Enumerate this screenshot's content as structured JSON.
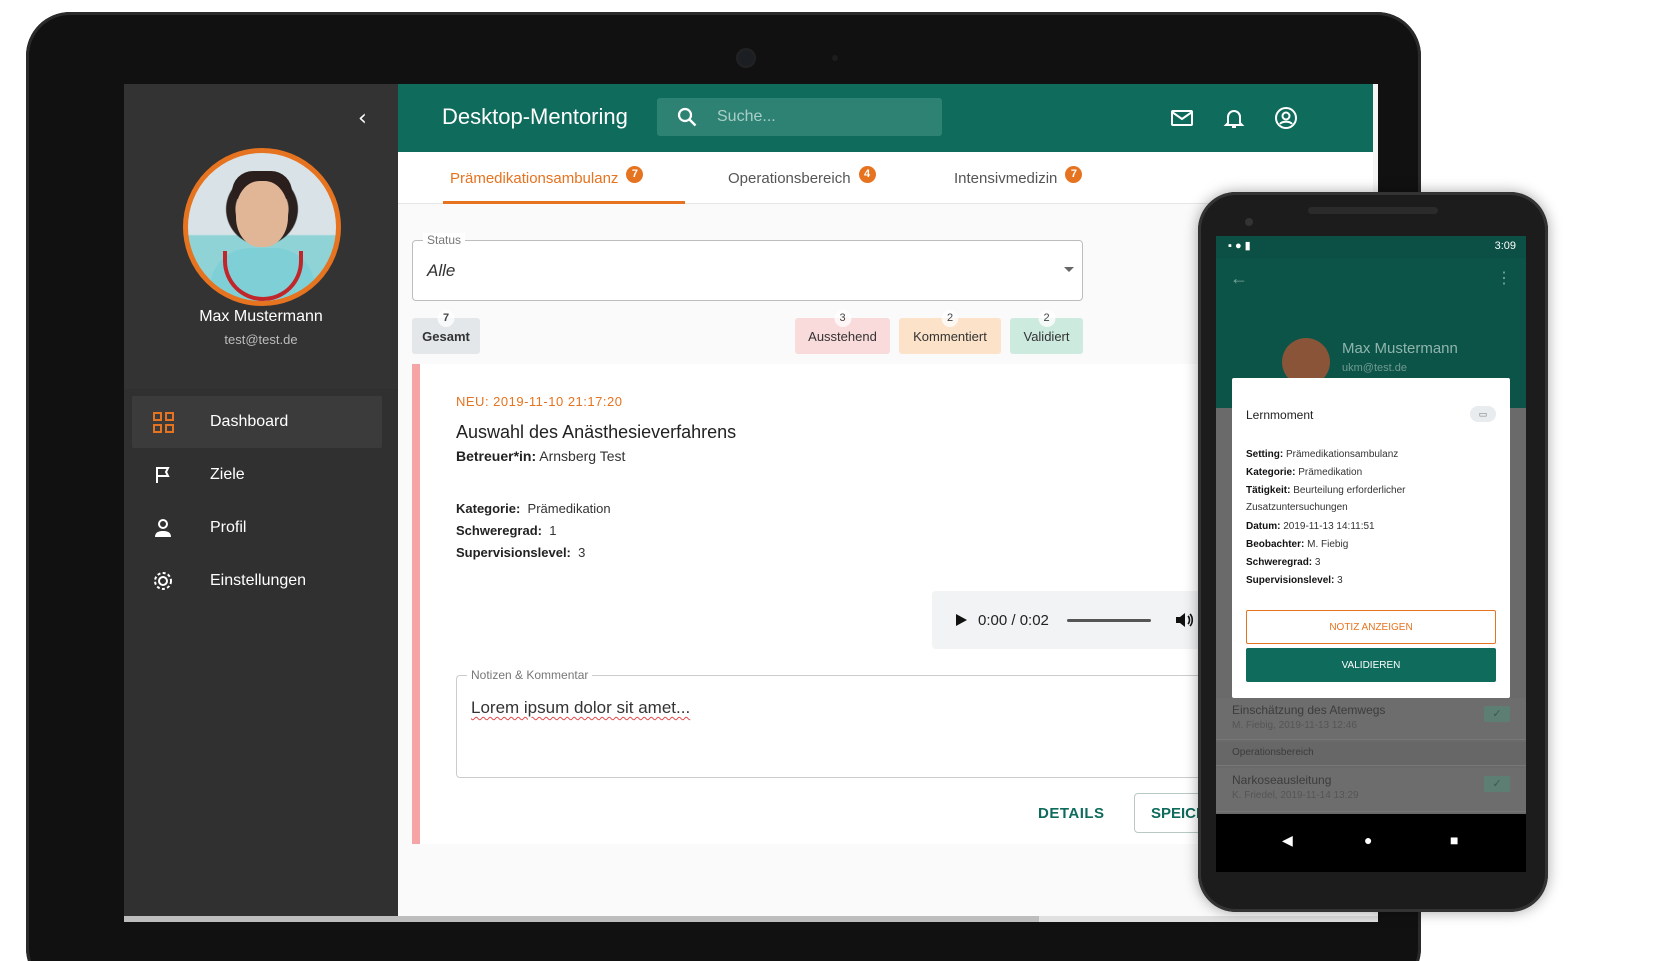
{
  "colors": {
    "primary": "#0f6b5c",
    "accent": "#e6731f",
    "sidebar": "#303030",
    "pending": "#fadbdb",
    "commented": "#fbe2c9",
    "validated": "#cdeadf",
    "overall": "#e3e7ea"
  },
  "sidebar": {
    "collapse_icon": "chevron-left-icon",
    "user_name": "Max Mustermann",
    "user_email": "test@test.de",
    "items": [
      {
        "label": "Dashboard",
        "icon": "dashboard-icon",
        "active": true
      },
      {
        "label": "Ziele",
        "icon": "flag-icon",
        "active": false
      },
      {
        "label": "Profil",
        "icon": "person-icon",
        "active": false
      },
      {
        "label": "Einstellungen",
        "icon": "gear-icon",
        "active": false
      }
    ]
  },
  "header": {
    "title": "Desktop-Mentoring",
    "search_placeholder": "Suche...",
    "icons": [
      "mail-icon",
      "bell-icon",
      "account-icon"
    ]
  },
  "tabs": [
    {
      "label": "Prämedikationsambulanz",
      "badge": "7",
      "active": true
    },
    {
      "label": "Operationsbereich",
      "badge": "4",
      "active": false
    },
    {
      "label": "Intensivmedizin",
      "badge": "7",
      "active": false
    }
  ],
  "filter": {
    "legend": "Status",
    "value": "Alle"
  },
  "chips": [
    {
      "label": "Gesamt",
      "count": "7"
    },
    {
      "label": "Ausstehend",
      "count": "3"
    },
    {
      "label": "Kommentiert",
      "count": "2"
    },
    {
      "label": "Validiert",
      "count": "2"
    }
  ],
  "card": {
    "new_label": "NEU: 2019-11-10 21:17:20",
    "title": "Auswahl des Anästhesieverfahrens",
    "supervisor_key": "Betreuer*in:",
    "supervisor_value": "Arnsberg Test",
    "category_key": "Kategorie:",
    "category_value": "Prämedikation",
    "severity_key": "Schweregrad:",
    "severity_value": "1",
    "supervision_key": "Supervisionslevel:",
    "supervision_value": "3",
    "audio_time": "0:00 / 0:02",
    "notes_legend": "Notizen & Kommentar",
    "notes_text": "Lorem ipsum dolor sit amet...",
    "details_label": "DETAILS",
    "save_label": "SPEICHERN"
  },
  "phone": {
    "time": "3:09",
    "user_name": "Max Mustermann",
    "user_email": "ukm@test.de",
    "dialog": {
      "title": "Lernmoment",
      "setting_key": "Setting:",
      "setting_value": "Prämedikationsambulanz",
      "category_key": "Kategorie:",
      "category_value": "Prämedikation",
      "activity_key": "Tätigkeit:",
      "activity_value": "Beurteilung erforderlicher Zusatzuntersuchungen",
      "date_key": "Datum:",
      "date_value": "2019-11-13 14:11:51",
      "observer_key": "Beobachter:",
      "observer_value": "M. Fiebig",
      "severity_key": "Schweregrad:",
      "severity_value": "3",
      "supervision_key": "Supervisionslevel:",
      "supervision_value": "3",
      "note_button": "NOTIZ ANZEIGEN",
      "validate_button": "VALIDIEREN"
    },
    "list": [
      {
        "title": "Einschätzung des Atemwegs",
        "sub": "M. Fiebig, 2019-11-13 12:46"
      },
      {
        "title": "Operationsbereich",
        "sub": ""
      },
      {
        "title": "Narkoseausleitung",
        "sub": "K. Friedel, 2019-11-14 13:29"
      }
    ]
  }
}
